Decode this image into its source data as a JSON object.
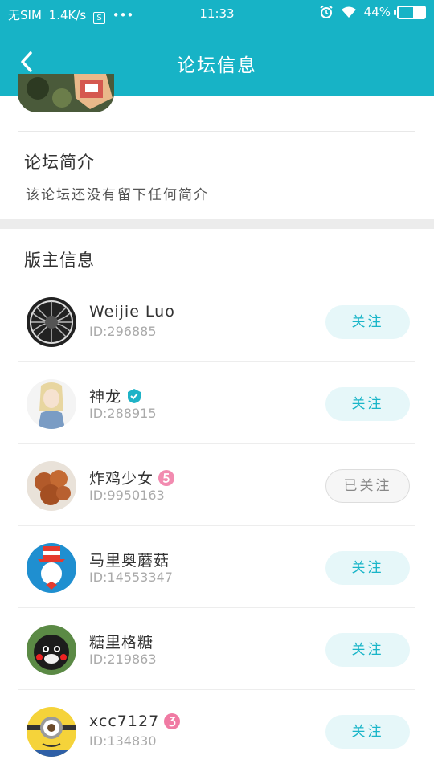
{
  "status_bar": {
    "carrier": "无SIM",
    "speed": "1.4K/s",
    "s_icon": "S",
    "dots": "•••",
    "time": "11:33",
    "battery_text": "44%",
    "battery_level": 0.44
  },
  "header": {
    "title": "论坛信息"
  },
  "intro": {
    "title": "论坛简介",
    "text": "该论坛还没有留下任何简介"
  },
  "moderators": {
    "title": "版主信息",
    "items": [
      {
        "name": "Weijie Luo",
        "id": "ID:296885",
        "badge": "",
        "button": "关注",
        "followed": false,
        "avatar": "sphere-photo"
      },
      {
        "name": "神龙",
        "id": "ID:288915",
        "badge": "verified-badge-icon",
        "button": "关注",
        "followed": false,
        "avatar": "anime-girl"
      },
      {
        "name": "炸鸡少女",
        "id": "ID:9950163",
        "badge": "level-5-badge-icon",
        "button": "已关注",
        "followed": true,
        "avatar": "fried-chicken"
      },
      {
        "name": "马里奥蘑菇",
        "id": "ID:14553347",
        "badge": "",
        "button": "关注",
        "followed": false,
        "avatar": "cat-in-hat"
      },
      {
        "name": "糖里格糖",
        "id": "ID:219863",
        "badge": "",
        "button": "关注",
        "followed": false,
        "avatar": "kumamon"
      },
      {
        "name": "xcc7127",
        "id": "ID:134830",
        "badge": "level-3-badge-icon",
        "button": "关注",
        "followed": false,
        "avatar": "minion"
      }
    ]
  },
  "colors": {
    "accent": "#17b3c6",
    "follow_text": "#19b5c8",
    "follow_bg": "#e6f7f9"
  }
}
